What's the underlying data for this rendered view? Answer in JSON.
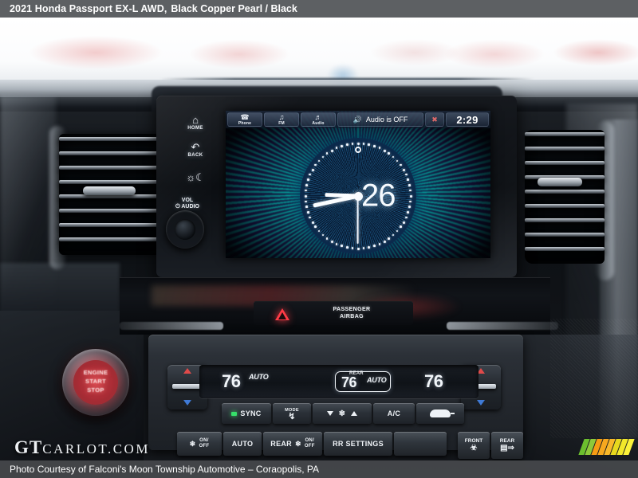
{
  "titlebar": {
    "vehicle": "2021 Honda Passport EX-L AWD,",
    "colors": "Black Copper Pearl / Black"
  },
  "footer": {
    "credit": "Photo Courtesy of Falconi's Moon Township Automotive – Coraopolis, PA"
  },
  "watermark": {
    "gt": "GT",
    "carlot": "CARLOT.COM",
    "slash_colors": [
      "#6cbf2e",
      "#8ec93a",
      "#f59b14",
      "#f7a81e",
      "#f9b82a",
      "#e8d81e",
      "#f2e82a",
      "#fbf23a"
    ]
  },
  "headunit": {
    "softkeys": [
      {
        "icon": "⌂",
        "label": "HOME",
        "name": "home"
      },
      {
        "icon": "↶",
        "label": "BACK",
        "name": "back"
      },
      {
        "icon": "☀☾",
        "label": "",
        "name": "day-night"
      }
    ],
    "volume_knob": {
      "label_line1": "VOL",
      "label_line2": "⏻ AUDIO"
    }
  },
  "screen": {
    "statusbar": {
      "buttons": [
        {
          "icon": "☎",
          "label": "Phone",
          "name": "phone"
        },
        {
          "icon": "♪",
          "label": "FM",
          "name": "fm"
        },
        {
          "icon": "♫",
          "label": "Audio",
          "name": "audio"
        }
      ],
      "audio_status": "Audio is OFF",
      "audio_icon": "🔊",
      "mute_icon": "✖",
      "clock": "2:29"
    },
    "clock_face": {
      "day_number": "26",
      "hour_hand_deg": 272,
      "minute_hand_deg": 258,
      "second_hand_deg": 180,
      "tick_count": 60
    },
    "palette": {
      "cyan": "#00ded0",
      "purple": "#3b1e8c",
      "dial_blue": "#0a2340"
    }
  },
  "center_panel": {
    "hazard_label": "hazard-warning",
    "airbag_indicator_line1": "PASSENGER",
    "airbag_indicator_line2": "AIRBAG"
  },
  "climate": {
    "driver_temp": "76",
    "driver_auto": "AUTO",
    "rear_label": "REAR",
    "rear_temp": "76",
    "rear_auto": "AUTO",
    "passenger_temp": "76",
    "buttons": [
      {
        "label": "SYNC",
        "name": "sync",
        "led": true
      },
      {
        "label_top": "MODE",
        "label_bottom": "↯",
        "name": "mode"
      },
      {
        "label": "",
        "name": "fan-speed"
      },
      {
        "label": "A/C",
        "name": "ac"
      },
      {
        "label": "",
        "name": "recirculation"
      }
    ],
    "bottom_buttons": [
      {
        "label_on": "ON/",
        "label_off": "OFF",
        "prefix": "❆",
        "name": "fan-on-off"
      },
      {
        "label": "AUTO",
        "name": "auto"
      },
      {
        "label": "REAR",
        "label_on": "ON/",
        "label_off": "OFF",
        "prefix": "❆",
        "name": "rear-on-off"
      },
      {
        "label": "RR SETTINGS",
        "name": "rr-settings"
      },
      {
        "label": "",
        "name": "blank-button"
      }
    ],
    "defrost": [
      {
        "label": "FRONT",
        "glyph": "☲",
        "name": "front-defrost"
      },
      {
        "label": "REAR",
        "glyph": "☰",
        "name": "rear-defrost"
      }
    ],
    "sync_led_color": "#36e06a"
  },
  "engine": {
    "label_line1": "ENGINE",
    "label_line2": "START",
    "label_line3": "STOP",
    "glow_color": "#d4484f"
  }
}
